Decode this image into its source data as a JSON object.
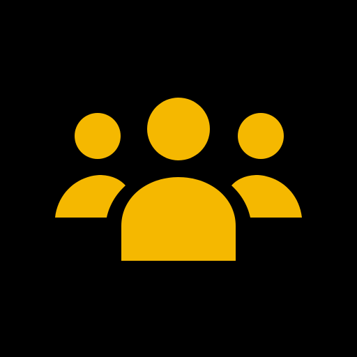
{
  "icon": {
    "name": "group-icon",
    "foreground": "#F5B800",
    "background": "#000000"
  }
}
